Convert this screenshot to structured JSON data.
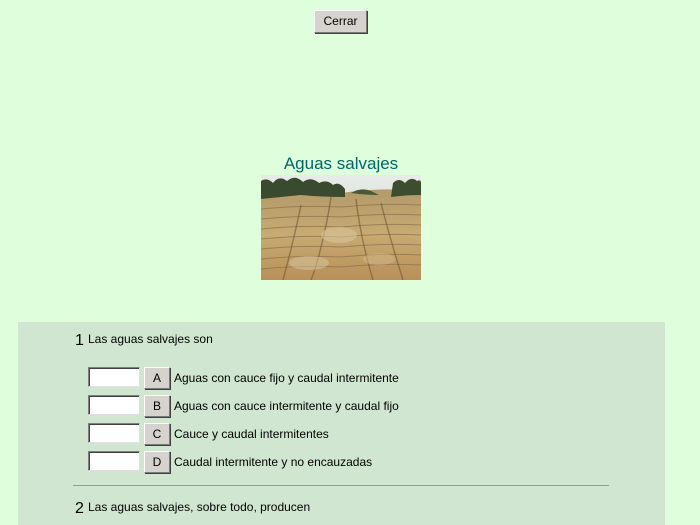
{
  "close_label": "Cerrar",
  "title": "Aguas salvajes",
  "photo_alt": "",
  "questions": [
    {
      "number": "1",
      "text": "Las aguas salvajes son",
      "options": [
        {
          "letter": "A",
          "text": "Aguas con cauce fijo y caudal intermitente",
          "answer": ""
        },
        {
          "letter": "B",
          "text": "Aguas con cauce intermitente y caudal fijo",
          "answer": ""
        },
        {
          "letter": "C",
          "text": "Cauce y caudal intermitentes",
          "answer": ""
        },
        {
          "letter": "D",
          "text": "Caudal intermitente y no encauzadas",
          "answer": ""
        }
      ]
    },
    {
      "number": "2",
      "text": "Las aguas salvajes, sobre todo, producen"
    }
  ],
  "colors": {
    "page_background": "#dfffdc",
    "panel_background": "#d0e6d0",
    "title": "#006666"
  }
}
